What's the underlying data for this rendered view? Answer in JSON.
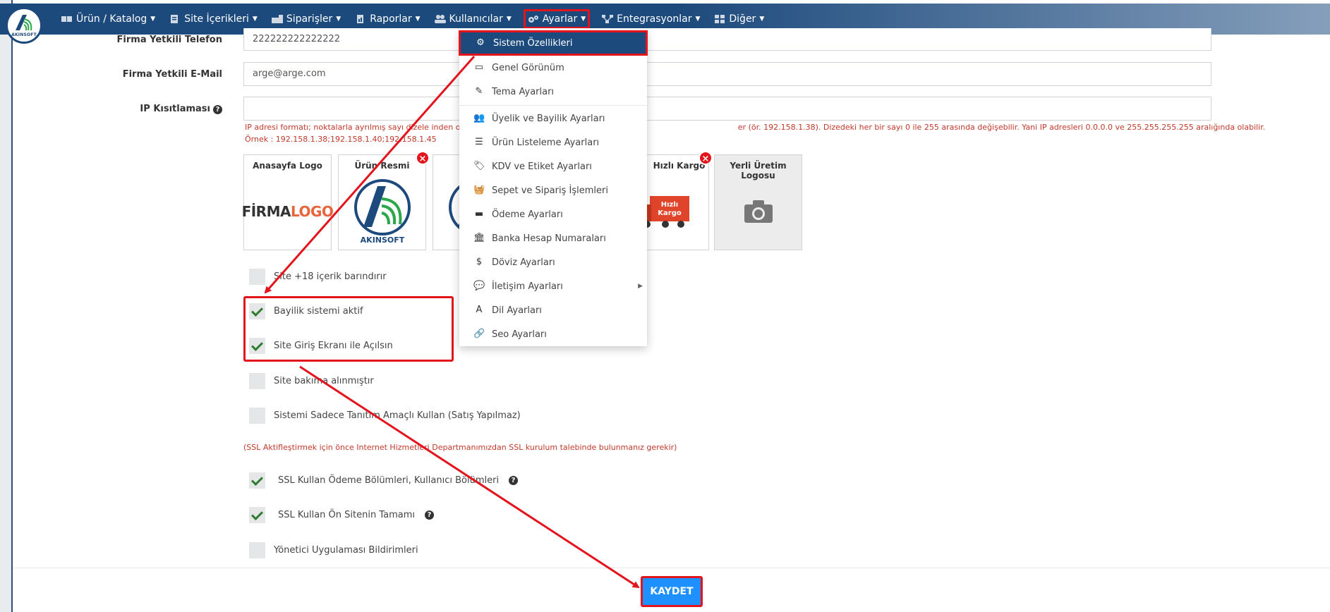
{
  "nav": {
    "logo_text": "AKINSOFT",
    "items": [
      {
        "label": "Ürün / Katalog",
        "icon": "catalog-icon"
      },
      {
        "label": "Site İçerikleri",
        "icon": "content-icon"
      },
      {
        "label": "Siparişler",
        "icon": "orders-icon"
      },
      {
        "label": "Raporlar",
        "icon": "reports-icon"
      },
      {
        "label": "Kullanıcılar",
        "icon": "users-icon"
      },
      {
        "label": "Ayarlar",
        "icon": "gears-icon"
      },
      {
        "label": "Entegrasyonlar",
        "icon": "sitemap-icon"
      },
      {
        "label": "Diğer",
        "icon": "grid-icon"
      }
    ]
  },
  "form": {
    "phone_label": "Firma Yetkili Telefon",
    "phone_value": "222222222222222",
    "email_label": "Firma Yetkili E-Mail",
    "email_value": "arge@arge.com",
    "ip_label": "IP Kısıtlaması",
    "ip_value": "",
    "ip_note_line1": "IP adresi formatı; noktalarla ayrılmış sayı dizele inden oluşma                                                                                                       er (ör. 192.158.1.38). Dizedeki her bir sayı 0 ile 255 arasında değişebilir. Yani IP adresleri 0.0.0.0 ve 255.255.255.255 aralığında olabilir.",
    "ip_note_line2": "Örnek : 192.158.1.38;192.158.1.40;192.158.1.45"
  },
  "images": {
    "cards": [
      {
        "title": "Anasayfa Logo",
        "deletable": false
      },
      {
        "title": "Ürün Resmi",
        "deletable": true
      },
      {
        "title": "",
        "deletable": false
      },
      {
        "title": "Hızlı Kargo",
        "deletable": true
      },
      {
        "title": "Yerli Üretim Logosu",
        "deletable": false
      }
    ],
    "firma_logo_a": "FİRMA",
    "firma_logo_b": "LOGO",
    "akinsoft_text": "AKINSOFT",
    "kargo_text_1": "Hızlı",
    "kargo_text_2": "Kargo"
  },
  "options": [
    {
      "label": "Site +18 içerik barındırır",
      "checked": false
    },
    {
      "label": "Bayilik sistemi aktif",
      "checked": true
    },
    {
      "label": "Site Giriş Ekranı ile Açılsın",
      "checked": true
    },
    {
      "label": "Site bakıma alınmıştır",
      "checked": false
    },
    {
      "label": "Sistemi Sadece Tanıtım Amaçlı Kullan (Satış Yapılmaz)",
      "checked": false
    }
  ],
  "ssl_note": "(SSL Aktifleştirmek için önce Internet Hizmetleri Departmanımızdan SSL kurulum talebinde bulunmanız gerekir)",
  "ssl_options": [
    {
      "label": "SSL Kullan Ödeme Bölümleri, Kullanıcı Bölümleri",
      "checked": true
    },
    {
      "label": "SSL Kullan Ön Sitenin Tamamı",
      "checked": true
    },
    {
      "label": "Yönetici Uygulaması Bildirimleri",
      "checked": false
    }
  ],
  "save_label": "KAYDET",
  "dropdown": {
    "items": [
      {
        "label": "Sistem Özellikleri",
        "icon": "gears-icon",
        "glyph": "⚙"
      },
      {
        "label": "Genel Görünüm",
        "icon": "monitor-icon",
        "glyph": "▭"
      },
      {
        "label": "Tema Ayarları",
        "icon": "brush-icon",
        "glyph": "✎"
      },
      {
        "label": "Üyelik ve Bayilik Ayarları",
        "icon": "users-icon",
        "glyph": "👥"
      },
      {
        "label": "Ürün Listeleme Ayarları",
        "icon": "list-icon",
        "glyph": "☰"
      },
      {
        "label": "KDV ve Etiket Ayarları",
        "icon": "tags-icon",
        "glyph": "🏷"
      },
      {
        "label": "Sepet ve Sipariş İşlemleri",
        "icon": "basket-icon",
        "glyph": "🧺"
      },
      {
        "label": "Ödeme Ayarları",
        "icon": "credit-card-icon",
        "glyph": "▬"
      },
      {
        "label": "Banka Hesap Numaraları",
        "icon": "bank-icon",
        "glyph": "🏛"
      },
      {
        "label": "Döviz Ayarları",
        "icon": "dollar-icon",
        "glyph": "$"
      },
      {
        "label": "İletişim Ayarları",
        "icon": "comments-icon",
        "glyph": "💬"
      },
      {
        "label": "Dil Ayarları",
        "icon": "language-icon",
        "glyph": "A"
      },
      {
        "label": "Seo Ayarları",
        "icon": "link-icon",
        "glyph": "🔗"
      }
    ]
  }
}
